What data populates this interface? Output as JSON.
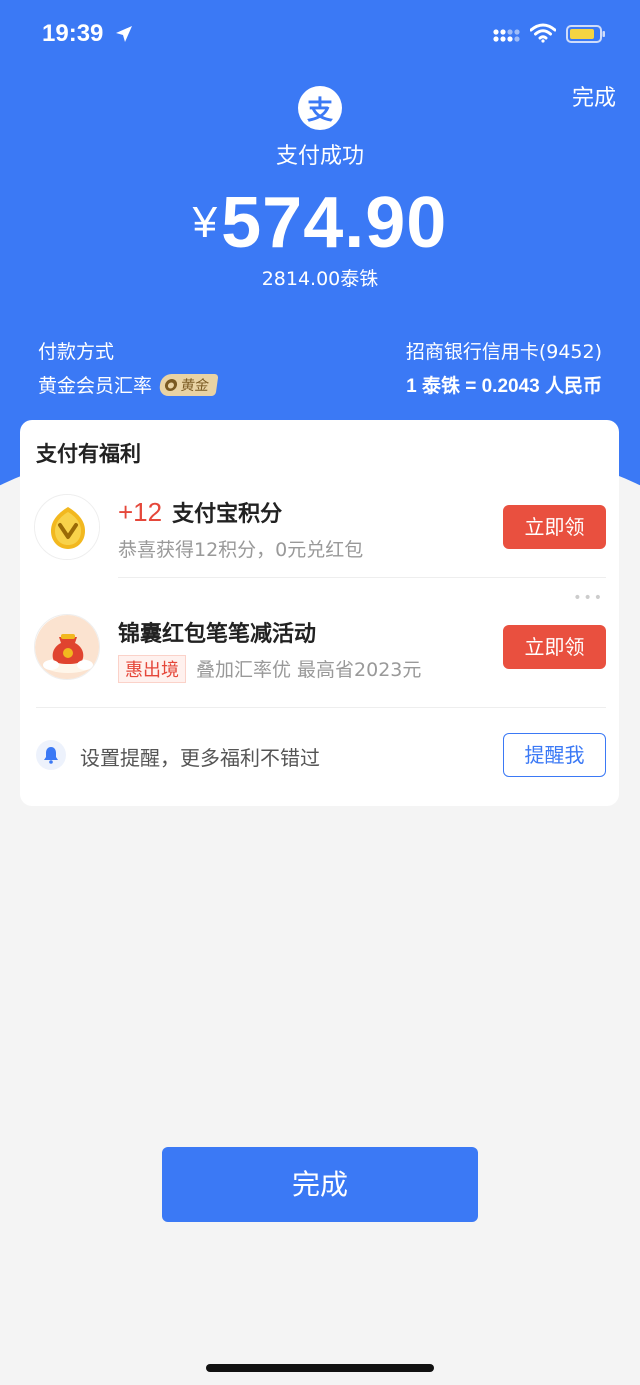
{
  "status_bar": {
    "time": "19:39"
  },
  "header": {
    "done_label": "完成",
    "logo_char": "支",
    "title": "支付成功",
    "currency_symbol": "¥",
    "amount": "574.90",
    "amount_local": "2814.00泰铢",
    "payment_method_label": "付款方式",
    "payment_method_value": "招商银行信用卡(9452)",
    "rate_label": "黄金会员汇率",
    "rate_badge": "黄金",
    "rate_value": "1 泰铢 = 0.2043 人民币"
  },
  "benefits": {
    "title": "支付有福利",
    "items": [
      {
        "prefix": "+12",
        "title": "支付宝积分",
        "desc": "恭喜获得12积分，0元兑红包",
        "button": "立即领"
      },
      {
        "title": "锦囊红包笔笔减活动",
        "tag": "惠出境",
        "desc": "叠加汇率优 最高省2023元",
        "button": "立即领"
      }
    ],
    "reminder_text": "设置提醒，更多福利不错过",
    "reminder_button": "提醒我"
  },
  "footer": {
    "done_label": "完成"
  },
  "colors": {
    "brand_blue": "#3b79f5",
    "claim_red": "#e9503f"
  }
}
